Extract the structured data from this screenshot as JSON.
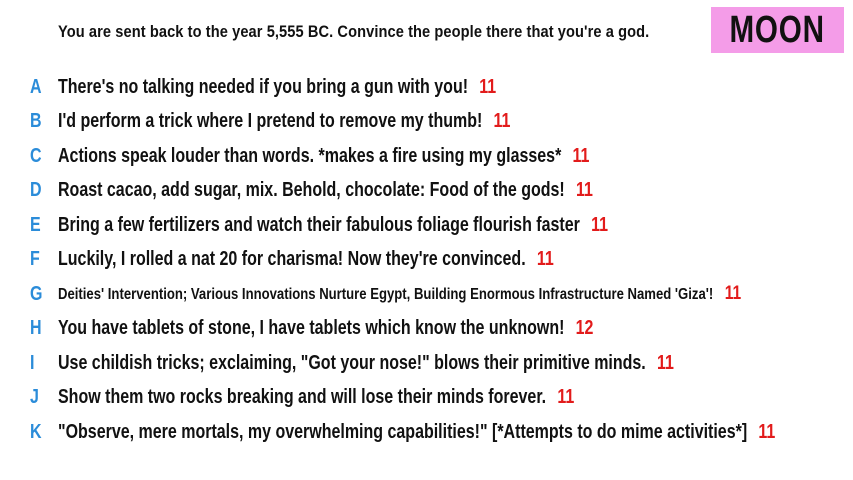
{
  "question": "You are sent back to the year 5,555 BC. Convince the people there that you're a god.",
  "badge": "MOON",
  "colors": {
    "letter": "#2b8cd9",
    "score": "#e21b1b",
    "badge_bg": "#f49ce8"
  },
  "answers": [
    {
      "letter": "A",
      "text": "There's no talking needed if you bring a gun with you!",
      "score": "11"
    },
    {
      "letter": "B",
      "text": "I'd perform a trick where I pretend to remove my thumb!",
      "score": "11"
    },
    {
      "letter": "C",
      "text": "Actions speak louder than words. *makes a fire using my glasses*",
      "score": "11"
    },
    {
      "letter": "D",
      "text": "Roast cacao, add sugar, mix. Behold, chocolate: Food of the gods!",
      "score": "11"
    },
    {
      "letter": "E",
      "text": "Bring a few fertilizers and watch their fabulous foliage flourish faster",
      "score": "11"
    },
    {
      "letter": "F",
      "text": "Luckily, I rolled a nat 20 for charisma! Now they're convinced.",
      "score": "11"
    },
    {
      "letter": "G",
      "text": "Deities' Intervention; Various Innovations Nurture Egypt, Building Enormous Infrastructure Named 'Giza'!",
      "score": "11"
    },
    {
      "letter": "H",
      "text": "You have tablets of stone, I have tablets which know the unknown!",
      "score": "12"
    },
    {
      "letter": "I",
      "text": "Use childish tricks; exclaiming, \"Got your nose!\" blows their primitive minds.",
      "score": "11"
    },
    {
      "letter": "J",
      "text": "Show them two rocks breaking and will lose their minds forever.",
      "score": "11"
    },
    {
      "letter": "K",
      "text": "\"Observe, mere mortals, my overwhelming capabilities!\" [*Attempts to do mime activities*]",
      "score": "11"
    }
  ]
}
